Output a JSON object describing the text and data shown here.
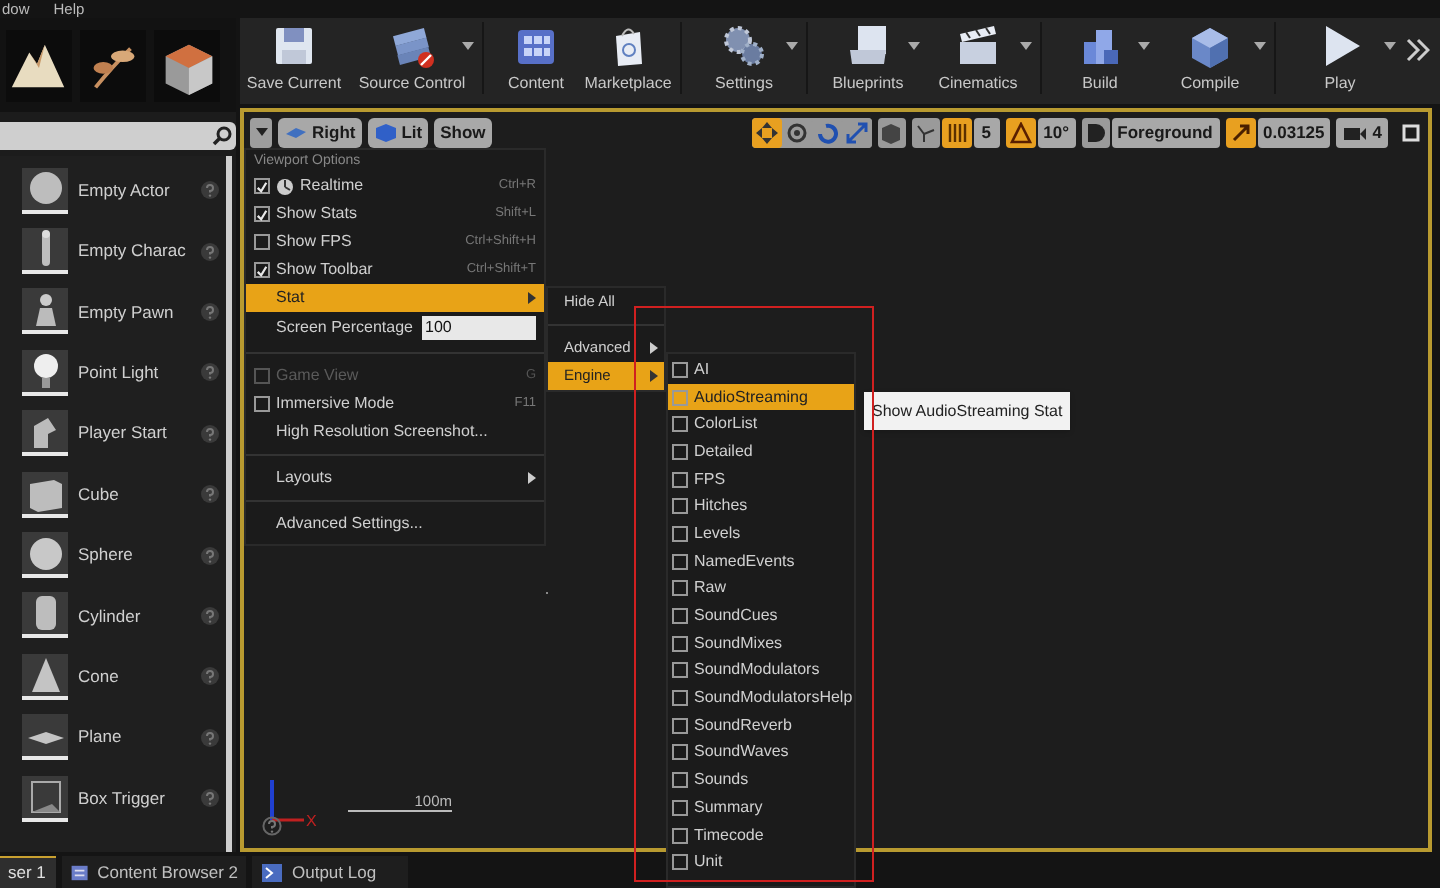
{
  "menubar": [
    "dow",
    "Help"
  ],
  "place_items": [
    {
      "label": "Empty Actor"
    },
    {
      "label": "Empty Charac"
    },
    {
      "label": "Empty Pawn"
    },
    {
      "label": "Point Light"
    },
    {
      "label": "Player Start"
    },
    {
      "label": "Cube"
    },
    {
      "label": "Sphere"
    },
    {
      "label": "Cylinder"
    },
    {
      "label": "Cone"
    },
    {
      "label": "Plane"
    },
    {
      "label": "Box Trigger"
    }
  ],
  "toolbar": [
    {
      "label": "Save Current",
      "dropdown": false
    },
    {
      "label": "Source Control",
      "dropdown": true
    },
    {
      "label": "Content",
      "dropdown": false
    },
    {
      "label": "Marketplace",
      "dropdown": false
    },
    {
      "label": "Settings",
      "dropdown": true
    },
    {
      "label": "Blueprints",
      "dropdown": true
    },
    {
      "label": "Cinematics",
      "dropdown": true
    },
    {
      "label": "Build",
      "dropdown": true
    },
    {
      "label": "Compile",
      "dropdown": true
    },
    {
      "label": "Play",
      "dropdown": true
    }
  ],
  "viewport_toolbar": {
    "view": "Right",
    "lighting": "Lit",
    "show": "Show",
    "grid_snap": "5",
    "rotation_snap": "10°",
    "layer": "Foreground",
    "scale_snap": "0.03125",
    "camera_speed": "4"
  },
  "viewport_options": {
    "header": "Viewport Options",
    "items": [
      {
        "kind": "checkbox",
        "label": "Realtime",
        "shortcut": "Ctrl+R",
        "checked": true,
        "disabled": false
      },
      {
        "kind": "checkbox",
        "label": "Show Stats",
        "shortcut": "Shift+L",
        "checked": true,
        "disabled": false
      },
      {
        "kind": "checkbox",
        "label": "Show FPS",
        "shortcut": "Ctrl+Shift+H",
        "checked": false,
        "disabled": false
      },
      {
        "kind": "checkbox",
        "label": "Show Toolbar",
        "shortcut": "Ctrl+Shift+T",
        "checked": true,
        "disabled": false
      },
      {
        "kind": "submenu",
        "label": "Stat",
        "selected": true
      },
      {
        "kind": "field",
        "label": "Screen Percentage",
        "value": "100"
      },
      {
        "kind": "separator"
      },
      {
        "kind": "checkbox",
        "label": "Game View",
        "shortcut": "G",
        "checked": false,
        "disabled": true
      },
      {
        "kind": "checkbox",
        "label": "Immersive Mode",
        "shortcut": "F11",
        "checked": false,
        "disabled": false
      },
      {
        "kind": "plain",
        "label": "High Resolution Screenshot..."
      },
      {
        "kind": "separator"
      },
      {
        "kind": "submenu",
        "label": "Layouts",
        "selected": false
      },
      {
        "kind": "separator"
      },
      {
        "kind": "plain",
        "label": "Advanced Settings..."
      }
    ]
  },
  "stat_menu": [
    {
      "kind": "plain",
      "label": "Hide All"
    },
    {
      "kind": "separator"
    },
    {
      "kind": "submenu",
      "label": "Advanced",
      "selected": false
    },
    {
      "kind": "submenu",
      "label": "Engine",
      "selected": true
    }
  ],
  "engine_menu": [
    {
      "label": "AI",
      "checked": false,
      "selected": false
    },
    {
      "label": "AudioStreaming",
      "checked": false,
      "selected": true
    },
    {
      "label": "ColorList",
      "checked": false,
      "selected": false
    },
    {
      "label": "Detailed",
      "checked": false,
      "selected": false
    },
    {
      "label": "FPS",
      "checked": false,
      "selected": false
    },
    {
      "label": "Hitches",
      "checked": false,
      "selected": false
    },
    {
      "label": "Levels",
      "checked": false,
      "selected": false
    },
    {
      "label": "NamedEvents",
      "checked": false,
      "selected": false
    },
    {
      "label": "Raw",
      "checked": false,
      "selected": false
    },
    {
      "label": "SoundCues",
      "checked": false,
      "selected": false
    },
    {
      "label": "SoundMixes",
      "checked": false,
      "selected": false
    },
    {
      "label": "SoundModulators",
      "checked": false,
      "selected": false
    },
    {
      "label": "SoundModulatorsHelp",
      "checked": false,
      "selected": false
    },
    {
      "label": "SoundReverb",
      "checked": false,
      "selected": false
    },
    {
      "label": "SoundWaves",
      "checked": false,
      "selected": false
    },
    {
      "label": "Sounds",
      "checked": false,
      "selected": false
    },
    {
      "label": "Summary",
      "checked": false,
      "selected": false
    },
    {
      "label": "Timecode",
      "checked": false,
      "selected": false
    },
    {
      "label": "Unit",
      "checked": false,
      "selected": false
    }
  ],
  "tooltip": "Show AudioStreaming Stat",
  "viewport_overlay": {
    "axis_label": "X",
    "scale_label": "100m"
  },
  "bottom_tabs": [
    {
      "label": "ser 1",
      "selected": true
    },
    {
      "label": "Content Browser 2",
      "selected": false
    },
    {
      "label": "Output Log",
      "selected": false
    }
  ]
}
